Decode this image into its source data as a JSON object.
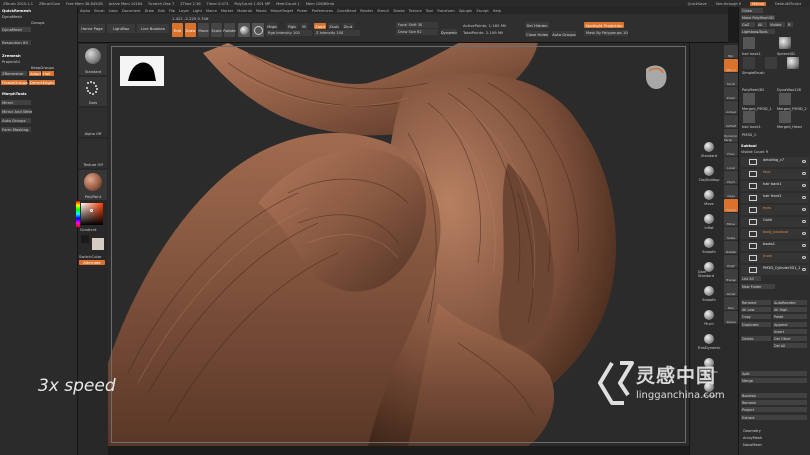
{
  "titlebar": {
    "items": [
      "ZBrush 2020.1.1",
      "ZBrushCore",
      "Free Mem 38.845GB",
      "Active Mem 10164",
      "Scratch Disk 7",
      "ZTime 2.36",
      "Timer 0.073",
      "PolyCount 1.901 MP",
      "MeshCount 1",
      "Mem 106/80mb"
    ],
    "right": [
      "QuickSave",
      "See-through 0",
      "Menus",
      "DefaultZScript"
    ]
  },
  "menubar": {
    "items": [
      "Alpha",
      "Brush",
      "Color",
      "Document",
      "Draw",
      "Edit",
      "File",
      "Layer",
      "Light",
      "Macro",
      "Marker",
      "Material",
      "Movie",
      "MorphTarget",
      "Picker",
      "Preferences",
      "QuickBend",
      "Render",
      "Stencil",
      "Stroke",
      "Texture",
      "Tool",
      "Transform",
      "Zplugin",
      "Zscript",
      "Help"
    ]
  },
  "toolbar": {
    "home_page": "Home Page",
    "lightbox": "LightBox",
    "live_boolean": "Live Boolean",
    "edit": "Edit",
    "draw": "Draw",
    "move": "Move",
    "scale": "Scale",
    "rotate": "Rotate",
    "mrgb": "Mrgb",
    "rgb": "Rgb",
    "m": "M",
    "zadd": "Zadd",
    "zsub": "Zsub",
    "zcut": "Zcut",
    "rgb_intensity": "Rgb Intensity 100",
    "z_intensity": "Z Intensity 100",
    "focal_shift": "Focal Shift 30",
    "draw_size": "Draw Size 62",
    "dynamic": "Dynamic",
    "active_points": "ActivePoints: 1.165 Mil",
    "total_points": "TotalPoints: 2.109 Mil",
    "del_hidden": "Del Hidden",
    "close_holes": "Close Holes",
    "auto_groups": "Auto Groups",
    "spotlight_projection": "Spotlight Projection",
    "mask_by_polygroups": "Mask By Polygroups 100",
    "coords": "1.421 -2.225 0.706"
  },
  "left_dock": {
    "quickmesh_title": "QuickRemesh",
    "dynamesh": "DynaMesh",
    "groups": "Groups",
    "dynamesh_btn": "DynaMesh",
    "resolution": "Resolution 80",
    "zremesh": "Zremesh",
    "project": "ProjectAll",
    "keepgroups": "KeepGroups",
    "zremesher": "ZRemesher",
    "adapt": "Adapt",
    "half": "Half",
    "freeze_groups": "FreezeGroups",
    "detect_edges": "DetectEdges",
    "morph_title": "MorphTools",
    "mirror": "Mirror",
    "mirror_weld": "Mirror And Weld",
    "auto_groups": "Auto Groups",
    "uv_masking": "Form Masking"
  },
  "left_shelf": {
    "standard": "Standard",
    "dots": "Dots",
    "alpha_off": "Alpha Off",
    "texture_off": "Texture Off",
    "polypaint": "PolyPaint",
    "gradient": "Gradient",
    "switch_color": "SwitchColor",
    "alternate": "Alternate"
  },
  "viewport": {
    "speed_text": "3x speed"
  },
  "right_shelf": {
    "buttons": [
      "Bpr",
      "SPix 3",
      "Scroll",
      "Zoom",
      "Actual",
      "AAHalf",
      "Dynamic Persp",
      "Floor",
      "Local",
      "LSym",
      "Gxyz",
      "Frame",
      "Move",
      "Scale",
      "Rotate",
      "PolyF",
      "Transp",
      "Ghost",
      "Solo",
      "Xpose"
    ],
    "tools": [
      "Standard",
      "ClayBuildup",
      "Move",
      "Inflat",
      "Smooth",
      "Dam Standard",
      "Smooth",
      "Pinch",
      "TrimDynamic",
      "ClayTubes",
      "hPolish"
    ]
  },
  "right_panel": {
    "close": "Close",
    "make_polymesh": "Make PolyMesh3D",
    "goz": "GoZ",
    "all": "All",
    "visible": "Visible",
    "r": "R",
    "lightbox_tools": "Lightbox▸Tools",
    "hair_back": "hair back1",
    "sphere3d": "Sphere3D",
    "simple_brush": "SimpleBrush",
    "polymesh3d": "PolyMesh3D",
    "dynawax": "DynaWax128",
    "merged_pm3d": "Merged_PM3D_1",
    "merged_pm3d2": "Merged_PM3D_2",
    "hair_back2": "hair back1",
    "merged_head": "Merged_Head",
    "pm3d_c": "PM3D_C",
    "subtool_title": "Subtool",
    "visible_count": "Visible Count 9",
    "subtools": [
      {
        "name": "detailing_c7",
        "orange": false
      },
      {
        "name": "face",
        "orange": true
      },
      {
        "name": "hair back1",
        "orange": false
      },
      {
        "name": "hair front1",
        "orange": false
      },
      {
        "name": "eyes",
        "orange": true
      },
      {
        "name": "Cloth",
        "orange": false
      },
      {
        "name": "body_blockout",
        "orange": true
      },
      {
        "name": "boots1",
        "orange": false
      },
      {
        "name": "trunk",
        "orange": true
      },
      {
        "name": "PM3D_Cylinder3D1_1",
        "orange": false
      }
    ],
    "list_all": "List All",
    "new_folder": "New Folder",
    "rename": "Rename",
    "auto_reorder": "AutoReorder",
    "all_low": "All Low",
    "all_high": "All High",
    "copy": "Copy",
    "paste": "Paste",
    "duplicate": "Duplicate",
    "append": "Append",
    "insert": "Insert",
    "delete": "Delete",
    "del_other": "Del Other",
    "del_all": "Del All",
    "split": "Split",
    "merge": "Merge",
    "boolean": "Boolean",
    "remesh": "Remesh",
    "project": "Project",
    "extract": "Extract",
    "geometry": "Geometry",
    "array_mesh": "ArrayMesh",
    "nano_mesh": "NanoMesh"
  },
  "watermark": {
    "cn": "灵感中国",
    "en": "lingganchina.com"
  },
  "colors": {
    "accent": "#d8722c",
    "clay": "#8a5a42"
  }
}
